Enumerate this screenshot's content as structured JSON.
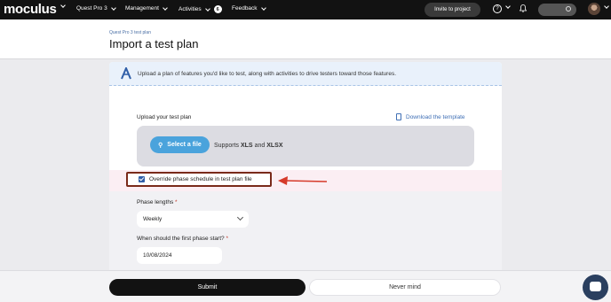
{
  "nav": {
    "logo": "moculus",
    "items": [
      {
        "label": "Quest Pro 3"
      },
      {
        "label": "Management"
      },
      {
        "label": "Activities",
        "badge": "6"
      },
      {
        "label": "Feedback"
      }
    ],
    "invite_label": "Invite to project",
    "help_glyph": "?"
  },
  "header": {
    "breadcrumb": "Quest Pro 3 test plan",
    "title": "Import a test plan"
  },
  "banner": {
    "text": "Upload a plan of features you'd like to test, along with activities to drive testers toward those features."
  },
  "upload": {
    "label": "Upload your test plan",
    "download_label": "Download the template",
    "select_button": "Select a file",
    "supports_prefix": "Supports",
    "format1": "XLS",
    "supports_and": "and",
    "format2": "XLSX"
  },
  "override": {
    "label": "Override phase schedule in test plan file",
    "checked": true
  },
  "phase": {
    "label": "Phase lengths",
    "required_mark": "*",
    "value": "Weekly"
  },
  "start": {
    "label": "When should the first phase start?",
    "required_mark": "*",
    "value": "10/08/2024"
  },
  "footer": {
    "submit_label": "Submit",
    "cancel_label": "Never mind"
  },
  "colors": {
    "nav_bg": "#121212",
    "accent_blue": "#4aa3dc",
    "annotation_red": "#d63a2a",
    "highlight_border": "#7a2a1a"
  },
  "icons": [
    "chevron-down-icon",
    "help-icon",
    "bell-icon",
    "search-icon",
    "avatar",
    "logo-a-icon",
    "document-icon",
    "paperclip-icon",
    "checkbox-checked-icon",
    "red-arrow-annotation",
    "chat-icon"
  ]
}
